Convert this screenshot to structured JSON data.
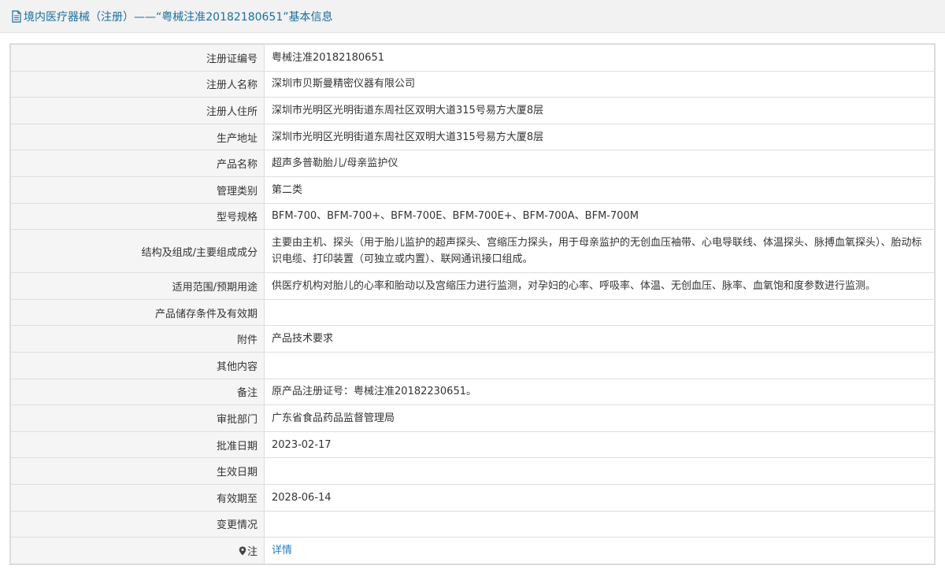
{
  "header": {
    "title": "境内医疗器械（注册）——“粤械注准20182180651”基本信息"
  },
  "rows": [
    {
      "label": "注册证编号",
      "value": "粤械注准20182180651"
    },
    {
      "label": "注册人名称",
      "value": "深圳市贝斯曼精密仪器有限公司"
    },
    {
      "label": "注册人住所",
      "value": "深圳市光明区光明街道东周社区双明大道315号易方大厦8层"
    },
    {
      "label": "生产地址",
      "value": "深圳市光明区光明街道东周社区双明大道315号易方大厦8层"
    },
    {
      "label": "产品名称",
      "value": "超声多普勒胎儿/母亲监护仪"
    },
    {
      "label": "管理类别",
      "value": "第二类"
    },
    {
      "label": "型号规格",
      "value": "BFM-700、BFM-700+、BFM-700E、BFM-700E+、BFM-700A、BFM-700M"
    },
    {
      "label": "结构及组成/主要组成成分",
      "value": "主要由主机、探头（用于胎儿监护的超声探头、宫缩压力探头，用于母亲监护的无创血压袖带、心电导联线、体温探头、脉搏血氧探头）、胎动标识电缆、打印装置（可独立或内置）、联网通讯接口组成。"
    },
    {
      "label": "适用范围/预期用途",
      "value": "供医疗机构对胎儿的心率和胎动以及宫缩压力进行监测，对孕妇的心率、呼吸率、体温、无创血压、脉率、血氧饱和度参数进行监测。"
    },
    {
      "label": "产品储存条件及有效期",
      "value": ""
    },
    {
      "label": "附件",
      "value": "产品技术要求"
    },
    {
      "label": "其他内容",
      "value": ""
    },
    {
      "label": "备注",
      "value": "原产品注册证号：粤械注准20182230651。"
    },
    {
      "label": "审批部门",
      "value": "广东省食品药品监督管理局"
    },
    {
      "label": "批准日期",
      "value": "2023-02-17"
    },
    {
      "label": "生效日期",
      "value": ""
    },
    {
      "label": "有效期至",
      "value": "2028-06-14"
    },
    {
      "label": "变更情况",
      "value": ""
    }
  ],
  "note_row": {
    "label": "注",
    "link_text": "详情"
  },
  "colors": {
    "title_text": "#1a6ea0",
    "link": "#2a7dc0",
    "label_bg": "#f5f5f5",
    "border": "#dedede"
  }
}
